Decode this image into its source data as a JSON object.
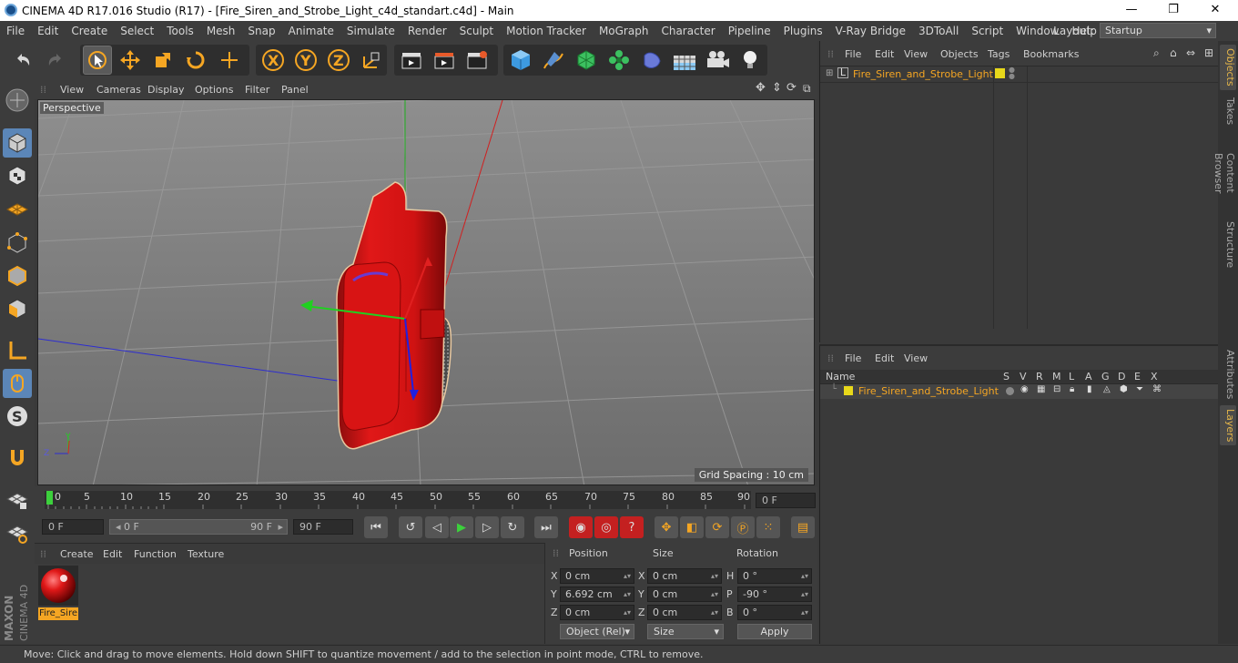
{
  "window": {
    "title": "CINEMA 4D R17.016 Studio (R17) - [Fire_Siren_and_Strobe_Light_c4d_standart.c4d] - Main",
    "minimize": "—",
    "maximize": "❐",
    "close": "✕"
  },
  "menu": [
    "File",
    "Edit",
    "Create",
    "Select",
    "Tools",
    "Mesh",
    "Snap",
    "Animate",
    "Simulate",
    "Render",
    "Sculpt",
    "Motion Tracker",
    "MoGraph",
    "Character",
    "Pipeline",
    "Plugins",
    "V-Ray Bridge",
    "3DToAll",
    "Script",
    "Window",
    "Help"
  ],
  "layout": {
    "label": "Layout:",
    "value": "Startup"
  },
  "viewport": {
    "menu": [
      "View",
      "Cameras",
      "Display",
      "Options",
      "Filter",
      "Panel"
    ],
    "label": "Perspective",
    "grid_spacing": "Grid Spacing : 10 cm",
    "axis_x": "X",
    "axis_y": "Y",
    "axis_z": "Z"
  },
  "timeline": {
    "ticks": [
      "0",
      "5",
      "10",
      "15",
      "20",
      "25",
      "30",
      "35",
      "40",
      "45",
      "50",
      "55",
      "60",
      "65",
      "70",
      "75",
      "80",
      "85",
      "90"
    ],
    "current_frame": "0 F"
  },
  "transport": {
    "start": "0 F",
    "range_start": "0 F",
    "range_end": "90 F",
    "end": "90 F"
  },
  "material_manager": {
    "menu": [
      "Create",
      "Edit",
      "Function",
      "Texture"
    ],
    "material_name": "Fire_Sire"
  },
  "coordinates": {
    "headers": {
      "position": "Position",
      "size": "Size",
      "rotation": "Rotation"
    },
    "rows": [
      {
        "axis": "X",
        "pos": "0 cm",
        "size_axis": "X",
        "size": "0 cm",
        "rot_axis": "H",
        "rot": "0 °"
      },
      {
        "axis": "Y",
        "pos": "6.692 cm",
        "size_axis": "Y",
        "size": "0 cm",
        "rot_axis": "P",
        "rot": "-90 °"
      },
      {
        "axis": "Z",
        "pos": "0 cm",
        "size_axis": "Z",
        "size": "0 cm",
        "rot_axis": "B",
        "rot": "0 °"
      }
    ],
    "mode": "Object (Rel)",
    "size_mode": "Size",
    "apply": "Apply"
  },
  "object_manager": {
    "menu": [
      "File",
      "Edit",
      "View",
      "Objects",
      "Tags",
      "Bookmarks"
    ],
    "object_name": "Fire_Siren_and_Strobe_Light",
    "color": "#e8d81a"
  },
  "layer_manager": {
    "menu": [
      "File",
      "Edit",
      "View"
    ],
    "columns": [
      "Name",
      "S",
      "V",
      "R",
      "M",
      "L",
      "A",
      "G",
      "D",
      "E",
      "X"
    ],
    "layer_name": "Fire_Siren_and_Strobe_Light"
  },
  "side_tabs": [
    "Objects",
    "Takes",
    "Content Browser",
    "Structure",
    "Attributes",
    "Layers"
  ],
  "status": "Move: Click and drag to move elements. Hold down SHIFT to quantize movement / add to the selection in point mode, CTRL to remove.",
  "logo": {
    "brand": "MAXON",
    "product": "CINEMA 4D"
  },
  "colors": {
    "accent": "#f5a623",
    "selection": "#5b86b8",
    "model": "#d41a1a"
  }
}
